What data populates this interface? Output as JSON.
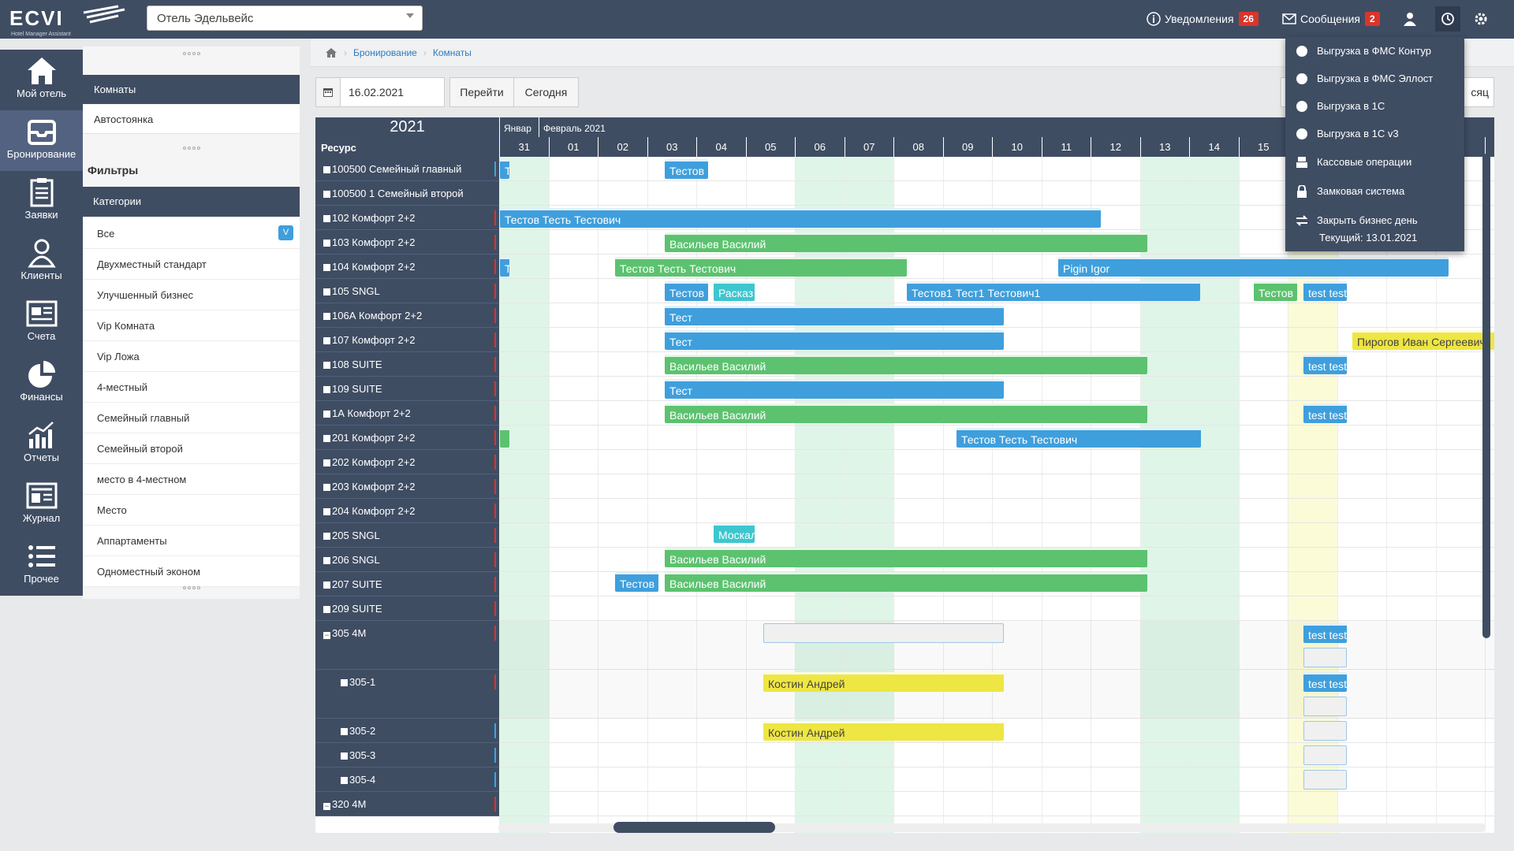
{
  "topbar": {
    "logo_text": "ECVI",
    "logo_subtitle": "Hotel Manager Assistant",
    "hotel_selected": "Отель Эдельвейс",
    "notifications_label": "Уведомления",
    "notifications_count": "26",
    "messages_label": "Сообщения",
    "messages_count": "2",
    "icons": [
      "info-icon",
      "mail-icon",
      "user-icon",
      "history-icon",
      "gear-icon"
    ]
  },
  "sidebar": {
    "items": [
      {
        "label": "Мой отель",
        "icon": "home-icon"
      },
      {
        "label": "Бронирование",
        "icon": "inbox-icon"
      },
      {
        "label": "Заявки",
        "icon": "clipboard-icon"
      },
      {
        "label": "Клиенты",
        "icon": "user-icon"
      },
      {
        "label": "Счета",
        "icon": "invoice-icon"
      },
      {
        "label": "Финансы",
        "icon": "pie-chart-icon"
      },
      {
        "label": "Отчеты",
        "icon": "bar-chart-icon"
      },
      {
        "label": "Журнал",
        "icon": "journal-icon"
      },
      {
        "label": "Прочее",
        "icon": "list-icon"
      }
    ]
  },
  "filters": {
    "tabs": [
      "Комнаты",
      "Автостоянка"
    ],
    "filters_title": "Фильтры",
    "categories_title": "Категории",
    "categories": [
      "Все",
      "Двухместный стандарт",
      "Улучшенный бизнес",
      "Vip Комната",
      "Vip Ложа",
      "4-местный",
      "Семейный главный",
      "Семейный второй",
      "место в 4-местном",
      "Место",
      "Аппартаменты",
      "Одноместный эконом"
    ],
    "all_badge": "V"
  },
  "breadcrumb": {
    "items": [
      "Бронирование",
      "Комнаты"
    ]
  },
  "toolbar": {
    "date_value": "16.02.2021",
    "go_label": "Перейти",
    "today_label": "Сегодня",
    "month_label_partial": "сяц"
  },
  "grid": {
    "year": "2021",
    "resource_header": "Ресурс",
    "month_jan": "Январ",
    "month_feb": "Февраль 2021",
    "days": [
      "31",
      "01",
      "02",
      "03",
      "04",
      "05",
      "06",
      "07",
      "08",
      "09",
      "10",
      "11",
      "12",
      "13",
      "14",
      "15",
      "",
      "",
      "",
      "",
      "2"
    ],
    "resources": [
      {
        "label": "100500 Семейный главный",
        "marker": "blue"
      },
      {
        "label": "100500 1 Семейный второй",
        "marker": "none"
      },
      {
        "label": "102 Комфорт 2+2",
        "marker": "red"
      },
      {
        "label": "103 Комфорт 2+2",
        "marker": "red"
      },
      {
        "label": "104 Комфорт 2+2",
        "marker": "red"
      },
      {
        "label": "105 SNGL",
        "marker": "red"
      },
      {
        "label": "106А Комфорт 2+2",
        "marker": "red"
      },
      {
        "label": "107 Комфорт 2+2",
        "marker": "red"
      },
      {
        "label": "108 SUITE",
        "marker": "red"
      },
      {
        "label": "109 SUITE",
        "marker": "red"
      },
      {
        "label": "1А Комфорт 2+2",
        "marker": "red"
      },
      {
        "label": "201 Комфорт 2+2",
        "marker": "red"
      },
      {
        "label": "202 Комфорт 2+2",
        "marker": "red"
      },
      {
        "label": "203 Комфорт 2+2",
        "marker": "red"
      },
      {
        "label": "204 Комфорт 2+2",
        "marker": "red"
      },
      {
        "label": "205 SNGL",
        "marker": "red"
      },
      {
        "label": "206 SNGL",
        "marker": "red"
      },
      {
        "label": "207 SUITE",
        "marker": "red"
      },
      {
        "label": "209 SUITE",
        "marker": "red"
      },
      {
        "label": "305 4М",
        "marker": "red"
      },
      {
        "label": "305-1",
        "marker": "red"
      },
      {
        "label": "305-2",
        "marker": "blue"
      },
      {
        "label": "305-3",
        "marker": "blue"
      },
      {
        "label": "305-4",
        "marker": "blue"
      },
      {
        "label": "320 4М",
        "marker": "red"
      }
    ],
    "bookings": [
      {
        "text": "Т",
        "color": "blue"
      },
      {
        "text": "Тестов",
        "color": "blue"
      },
      {
        "text": "Тестов Тесть Тестович",
        "color": "blue"
      },
      {
        "text": "Васильев Василий",
        "color": "green"
      },
      {
        "text": "Т",
        "color": "blue"
      },
      {
        "text": "Тестов Тесть Тестович",
        "color": "green"
      },
      {
        "text": "Pigin Igor",
        "color": "blue"
      },
      {
        "text": "Тестов",
        "color": "blue"
      },
      {
        "text": "Расказ",
        "color": "teal"
      },
      {
        "text": "Тестов1 Тест1 Тестович1",
        "color": "blue"
      },
      {
        "text": "Тестов",
        "color": "green"
      },
      {
        "text": "test test",
        "color": "blue"
      },
      {
        "text": "Тест",
        "color": "blue"
      },
      {
        "text": "Тест",
        "color": "blue"
      },
      {
        "text": "Пирогов Иван Сергеевич",
        "color": "yellow"
      },
      {
        "text": "Васильев Василий",
        "color": "green"
      },
      {
        "text": "test test",
        "color": "blue"
      },
      {
        "text": "Тест",
        "color": "blue"
      },
      {
        "text": "Васильев Василий",
        "color": "green"
      },
      {
        "text": "test test",
        "color": "blue"
      },
      {
        "text": "",
        "color": "green"
      },
      {
        "text": "Тестов Тесть Тестович",
        "color": "blue"
      },
      {
        "text": "Москал",
        "color": "teal"
      },
      {
        "text": "Васильев Василий",
        "color": "green"
      },
      {
        "text": "Тестов",
        "color": "blue"
      },
      {
        "text": "Васильев Василий",
        "color": "green"
      },
      {
        "text": "",
        "color": "grey"
      },
      {
        "text": "test test",
        "color": "blue"
      },
      {
        "text": "",
        "color": "grey"
      },
      {
        "text": "Костин Андрей",
        "color": "yellow"
      },
      {
        "text": "test test",
        "color": "blue"
      },
      {
        "text": "",
        "color": "grey"
      },
      {
        "text": "Костин Андрей",
        "color": "yellow"
      },
      {
        "text": "",
        "color": "grey"
      },
      {
        "text": "",
        "color": "grey"
      },
      {
        "text": "",
        "color": "grey"
      }
    ]
  },
  "dropdown": {
    "items": [
      "Выгрузка в ФМС Контур",
      "Выгрузка в ФМС Эллост",
      "Выгрузка в 1С",
      "Выгрузка в 1С v3",
      "Кассовые операции",
      "Замковая система",
      "Закрыть бизнес день"
    ],
    "current_day": "Текущий: 13.01.2021"
  },
  "colors": {
    "navy": "#3f4d63",
    "blue": "#3f9fdc",
    "green": "#5cc26f",
    "yellow": "#eee642",
    "teal": "#3ec6cf",
    "red": "#d9352b"
  }
}
